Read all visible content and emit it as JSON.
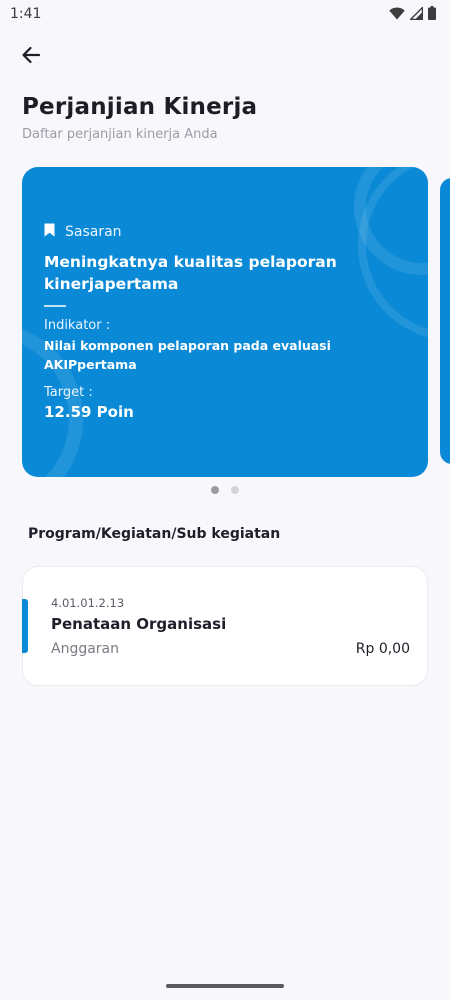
{
  "status_bar": {
    "time": "1:41",
    "icons": [
      "wifi-icon",
      "signal-icon",
      "battery-icon"
    ]
  },
  "header": {
    "back_icon": "arrow-left-icon",
    "title": "Perjanjian Kinerja",
    "subtitle": "Daftar perjanjian kinerja Anda"
  },
  "card": {
    "label_icon": "bookmark-icon",
    "label": "Sasaran",
    "goal": "Meningkatnya kualitas pelaporan kinerjapertama",
    "indikator_label": "Indikator :",
    "indikator_value": "Nilai komponen pelaporan pada evaluasi AKIPpertama",
    "target_label": "Target :",
    "target_value": "12.59 Poin"
  },
  "pager": {
    "count": 2,
    "active": 0
  },
  "section": {
    "title": "Program/Kegiatan/Sub kegiatan"
  },
  "program": {
    "code": "4.01.01.2.13",
    "name": "Penataan Organisasi",
    "budget_label": "Anggaran",
    "budget_value": "Rp 0,00"
  },
  "colors": {
    "accent": "#0a8ad6",
    "background": "#f8f7fb",
    "card_text": "#ffffff"
  }
}
